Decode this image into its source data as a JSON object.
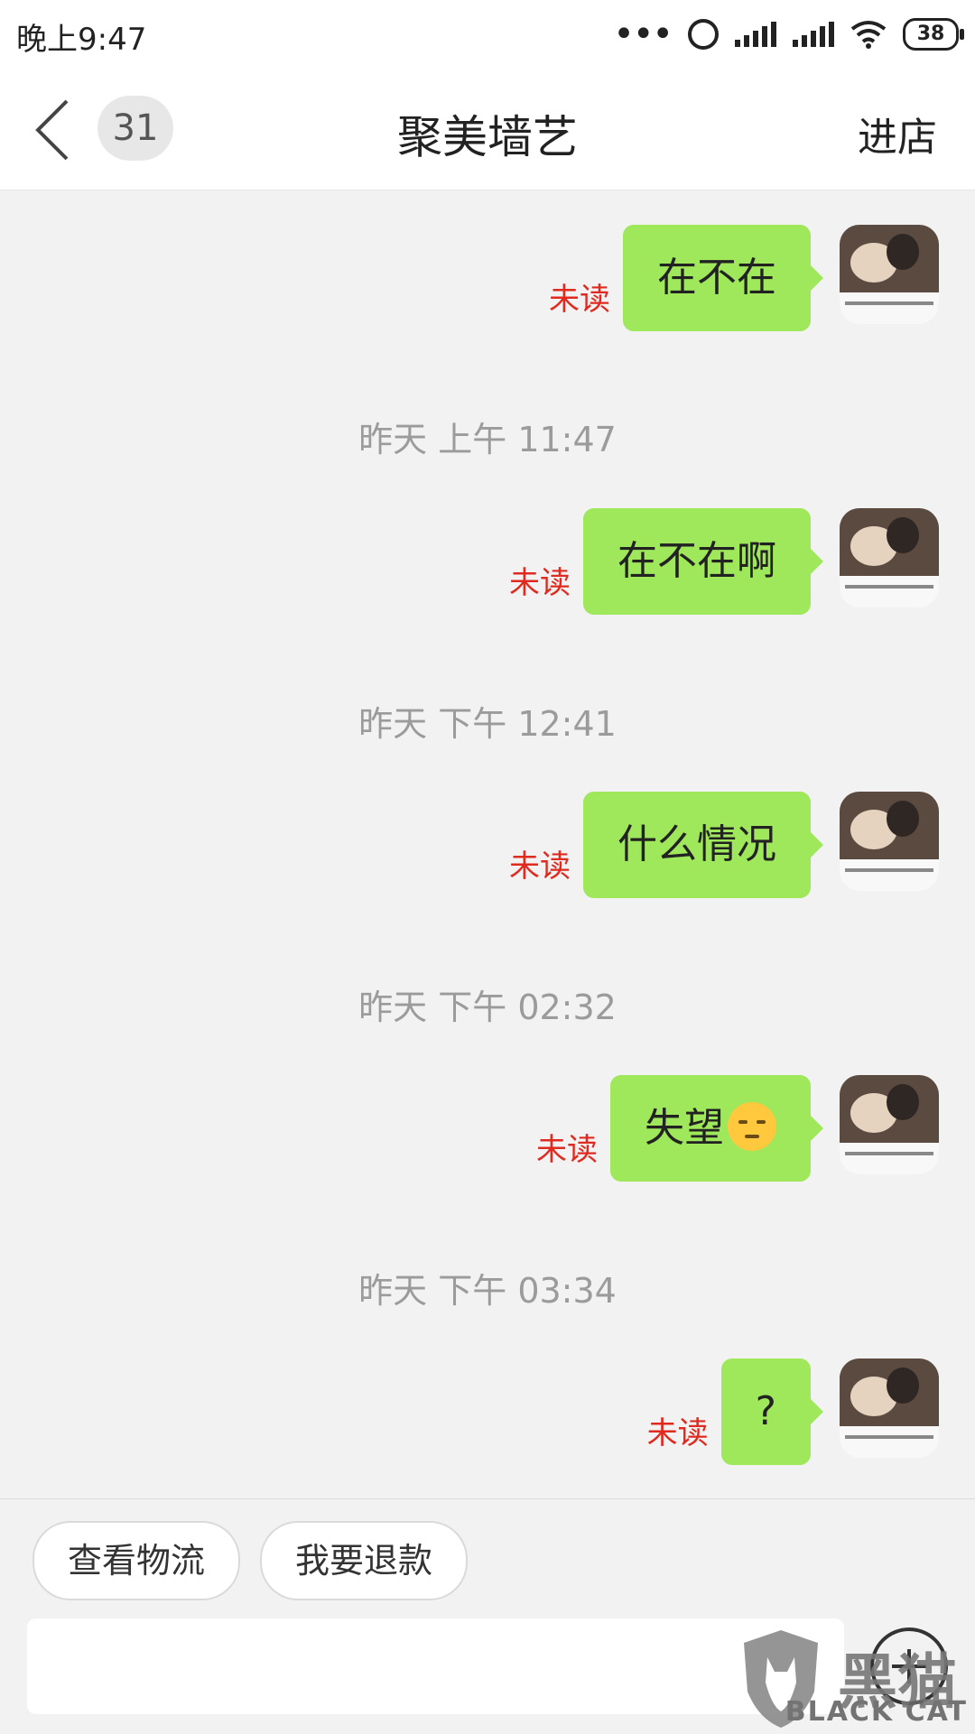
{
  "status_bar": {
    "time": "晚上9:47",
    "battery": "38"
  },
  "nav": {
    "unread_count": "31",
    "title": "聚美墙艺",
    "enter_store": "进店"
  },
  "messages": [
    {
      "text": "在不在",
      "status": "未读"
    },
    {
      "timestamp": "昨天 上午 11:47"
    },
    {
      "text": "在不在啊",
      "status": "未读"
    },
    {
      "timestamp": "昨天 下午 12:41"
    },
    {
      "text": "什么情况",
      "status": "未读"
    },
    {
      "timestamp": "昨天 下午 02:32"
    },
    {
      "text": "失望",
      "emoji": "disappointed-face-icon",
      "status": "未读"
    },
    {
      "timestamp": "昨天 下午 03:34"
    },
    {
      "text": "?",
      "status": "未读"
    }
  ],
  "quick_actions": {
    "logistics": "查看物流",
    "refund": "我要退款"
  },
  "watermark": {
    "cn": "黑猫",
    "en": "BLACK CAT"
  },
  "colors": {
    "bubble": "#9fe75b",
    "unread": "#e02a1f",
    "timestamp": "#9b9b9b"
  }
}
